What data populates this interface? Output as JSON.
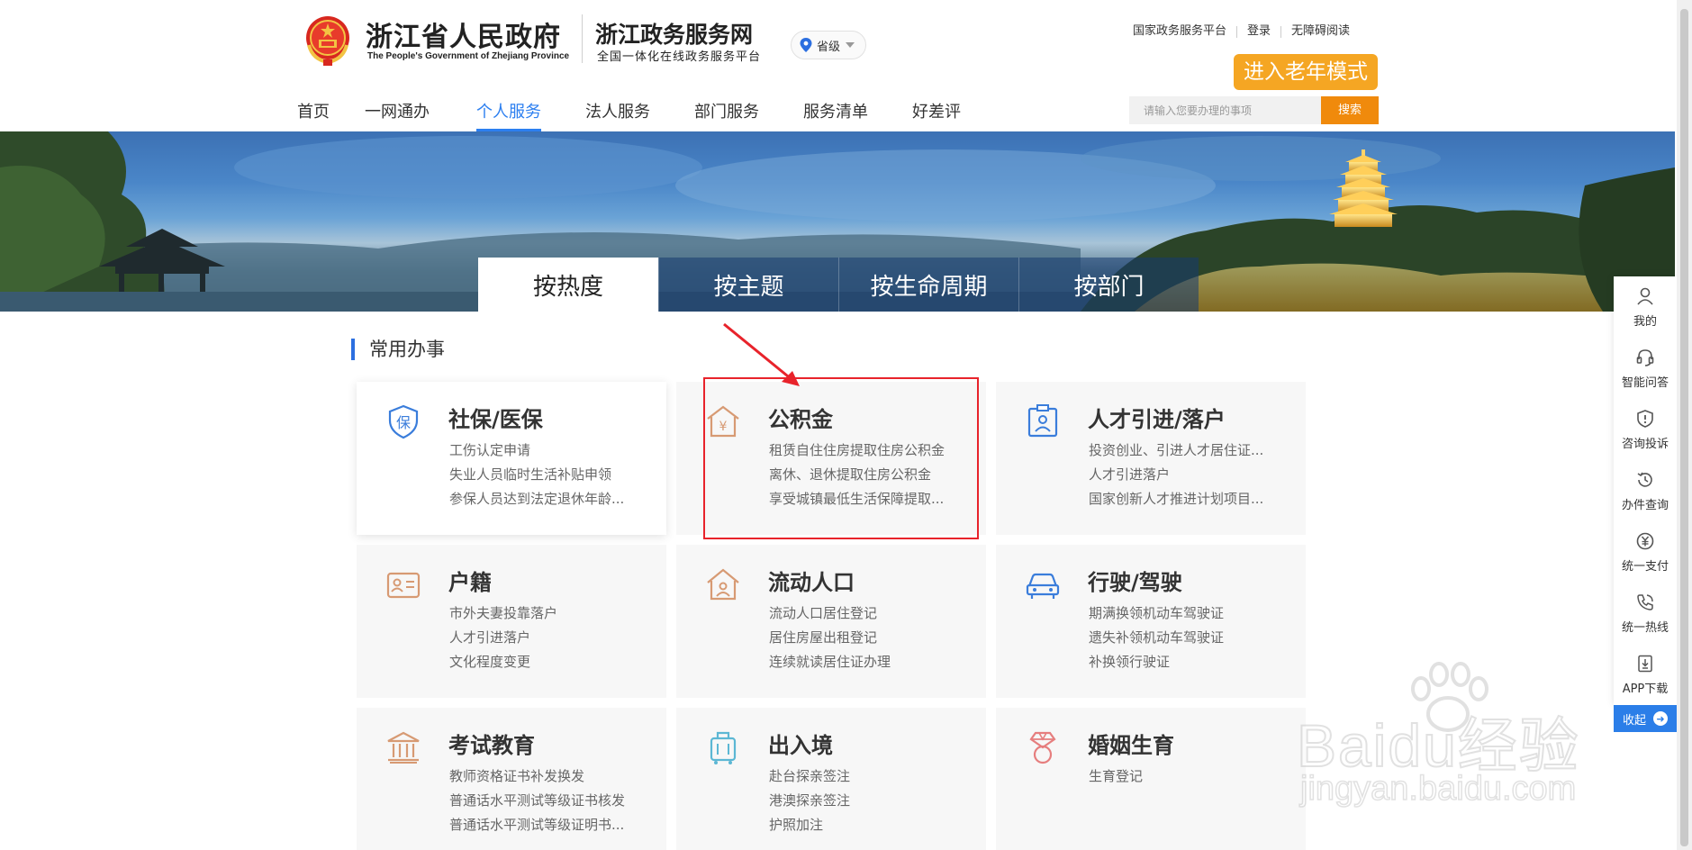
{
  "header": {
    "gov_title": "浙江省人民政府",
    "gov_subtitle": "The People's Government of Zhejiang Province",
    "site_title": "浙江政务服务网",
    "site_subtitle": "全国一体化在线政务服务平台",
    "region": "省级",
    "top_links": [
      "国家政务服务平台",
      "登录",
      "无障碍阅读"
    ],
    "elder_mode_label": "进入老年模式",
    "search_placeholder": "请输入您要办理的事项",
    "search_button": "搜索"
  },
  "nav": {
    "items": [
      "首页",
      "一网通办",
      "个人服务",
      "法人服务",
      "部门服务",
      "服务清单",
      "好差评"
    ],
    "active": "个人服务"
  },
  "banner_tabs": {
    "items": [
      "按热度",
      "按主题",
      "按生命周期",
      "按部门"
    ],
    "active": "按热度"
  },
  "section": {
    "title": "常用办事",
    "cards": [
      {
        "title": "社保/医保",
        "icon": "social-security-icon",
        "lines": [
          "工伤认定申请",
          "失业人员临时生活补贴申领",
          "参保人员达到法定退休年龄..."
        ]
      },
      {
        "title": "公积金",
        "icon": "housing-fund-icon",
        "lines": [
          "租赁自住住房提取住房公积金",
          "离休、退休提取住房公积金",
          "享受城镇最低生活保障提取..."
        ]
      },
      {
        "title": "人才引进/落户",
        "icon": "talent-badge-icon",
        "lines": [
          "投资创业、引进人才居住证...",
          "人才引进落户",
          "国家创新人才推进计划项目..."
        ]
      },
      {
        "title": "户籍",
        "icon": "id-card-icon",
        "lines": [
          "市外夫妻投靠落户",
          "人才引进落户",
          "文化程度变更"
        ]
      },
      {
        "title": "流动人口",
        "icon": "house-person-icon",
        "lines": [
          "流动人口居住登记",
          "居住房屋出租登记",
          "连续就读居住证办理"
        ]
      },
      {
        "title": "行驶/驾驶",
        "icon": "car-icon",
        "lines": [
          "期满换领机动车驾驶证",
          "遗失补领机动车驾驶证",
          "补换领行驶证"
        ]
      },
      {
        "title": "考试教育",
        "icon": "institution-icon",
        "lines": [
          "教师资格证书补发换发",
          "普通话水平测试等级证书核发",
          "普通话水平测试等级证明书..."
        ]
      },
      {
        "title": "出入境",
        "icon": "luggage-icon",
        "lines": [
          "赴台探亲签注",
          "港澳探亲签注",
          "护照加注"
        ]
      },
      {
        "title": "婚姻生育",
        "icon": "diamond-ring-icon",
        "lines": [
          "生育登记"
        ]
      }
    ]
  },
  "side_toolbar": {
    "items": [
      {
        "label": "我的",
        "icon": "user-icon"
      },
      {
        "label": "智能问答",
        "icon": "headset-icon"
      },
      {
        "label": "咨询投诉",
        "icon": "alert-shield-icon"
      },
      {
        "label": "办件查询",
        "icon": "history-icon"
      },
      {
        "label": "统一支付",
        "icon": "yuan-icon"
      },
      {
        "label": "统一热线",
        "icon": "phone-icon"
      },
      {
        "label": "APP下载",
        "icon": "download-icon"
      }
    ],
    "collapse_label": "收起"
  },
  "watermark": {
    "brand": "Baidu经验",
    "url": "jingyan.baidu.com"
  },
  "colors": {
    "primary_blue": "#2c7ff0",
    "orange": "#f5a623",
    "search_orange": "#f08a0c",
    "highlight_red": "#e8232b"
  }
}
